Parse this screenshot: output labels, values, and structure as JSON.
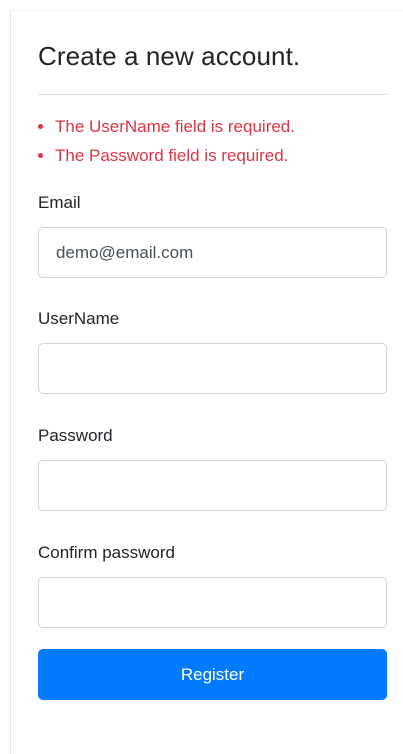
{
  "form": {
    "title": "Create a new account.",
    "validation_errors": [
      "The UserName field is required.",
      "The Password field is required."
    ],
    "fields": {
      "email": {
        "label": "Email",
        "value": "demo@email.com",
        "placeholder": ""
      },
      "username": {
        "label": "UserName",
        "value": "",
        "placeholder": ""
      },
      "password": {
        "label": "Password",
        "value": "",
        "placeholder": ""
      },
      "confirm_password": {
        "label": "Confirm password",
        "value": "",
        "placeholder": ""
      }
    },
    "register_label": "Register"
  },
  "colors": {
    "error": "#dc3545",
    "primary": "#007bff",
    "border": "#ced4da"
  }
}
